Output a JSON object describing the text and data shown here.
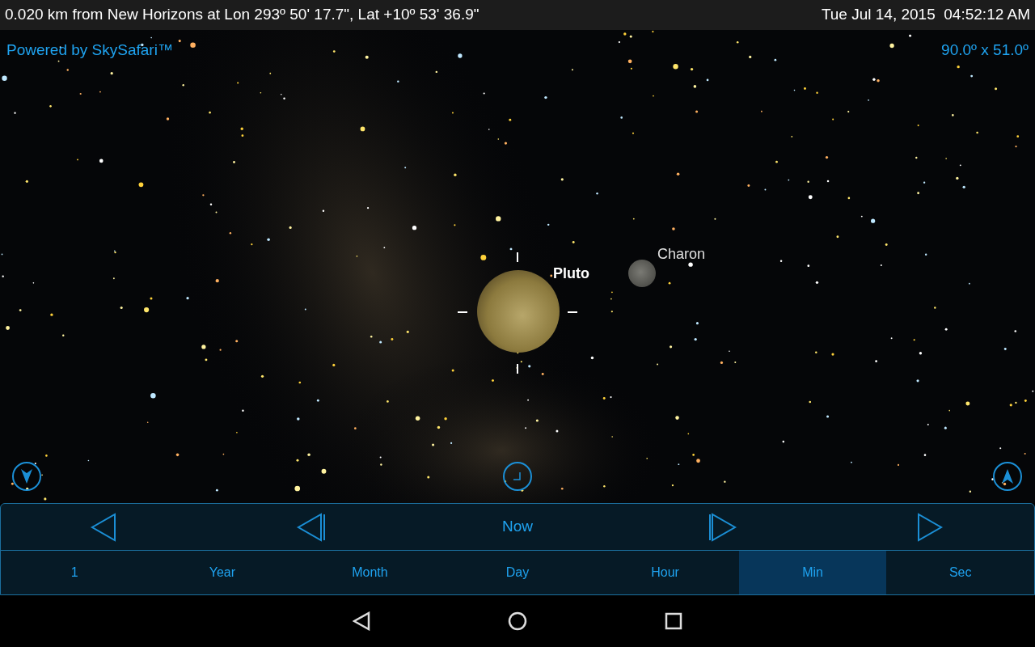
{
  "status_bar": {
    "location": "0.020 km from New Horizons at Lon 293º 50' 17.7\", Lat +10º 53' 36.9\"",
    "datetime": "Tue Jul 14, 2015  04:52:12 AM"
  },
  "sky": {
    "credit": "Powered by SkySafari™",
    "field_of_view": "90.0º x 51.0º",
    "objects": [
      {
        "kind": "planet",
        "label": "Pluto",
        "selected": true
      },
      {
        "kind": "moon",
        "label": "Charon",
        "selected": false
      }
    ]
  },
  "time_controls": {
    "now_label": "Now",
    "steps": [
      {
        "label": "1",
        "selected": false
      },
      {
        "label": "Year",
        "selected": false
      },
      {
        "label": "Month",
        "selected": false
      },
      {
        "label": "Day",
        "selected": false
      },
      {
        "label": "Hour",
        "selected": false
      },
      {
        "label": "Min",
        "selected": true
      },
      {
        "label": "Sec",
        "selected": false
      }
    ]
  }
}
